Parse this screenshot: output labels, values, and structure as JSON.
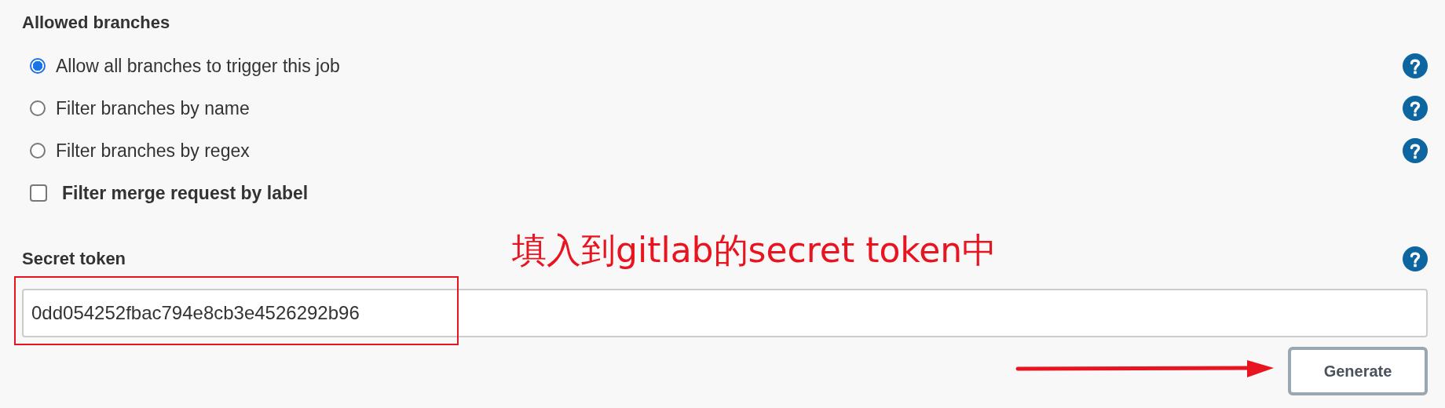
{
  "section_title": "Allowed branches",
  "options": [
    {
      "kind": "radio",
      "label": "Allow all branches to trigger this job",
      "selected": true,
      "help": true
    },
    {
      "kind": "radio",
      "label": "Filter branches by name",
      "selected": false,
      "help": true
    },
    {
      "kind": "radio",
      "label": "Filter branches by regex",
      "selected": false,
      "help": true
    },
    {
      "kind": "checkbox",
      "label": "Filter merge request by label",
      "checked": false,
      "help": false
    }
  ],
  "secret_token": {
    "label": "Secret token",
    "value": "0dd054252fbac794e8cb3e4526292b96",
    "help": true
  },
  "generate_button": "Generate",
  "annotation": {
    "text": "填入到gitlab的secret token中"
  }
}
